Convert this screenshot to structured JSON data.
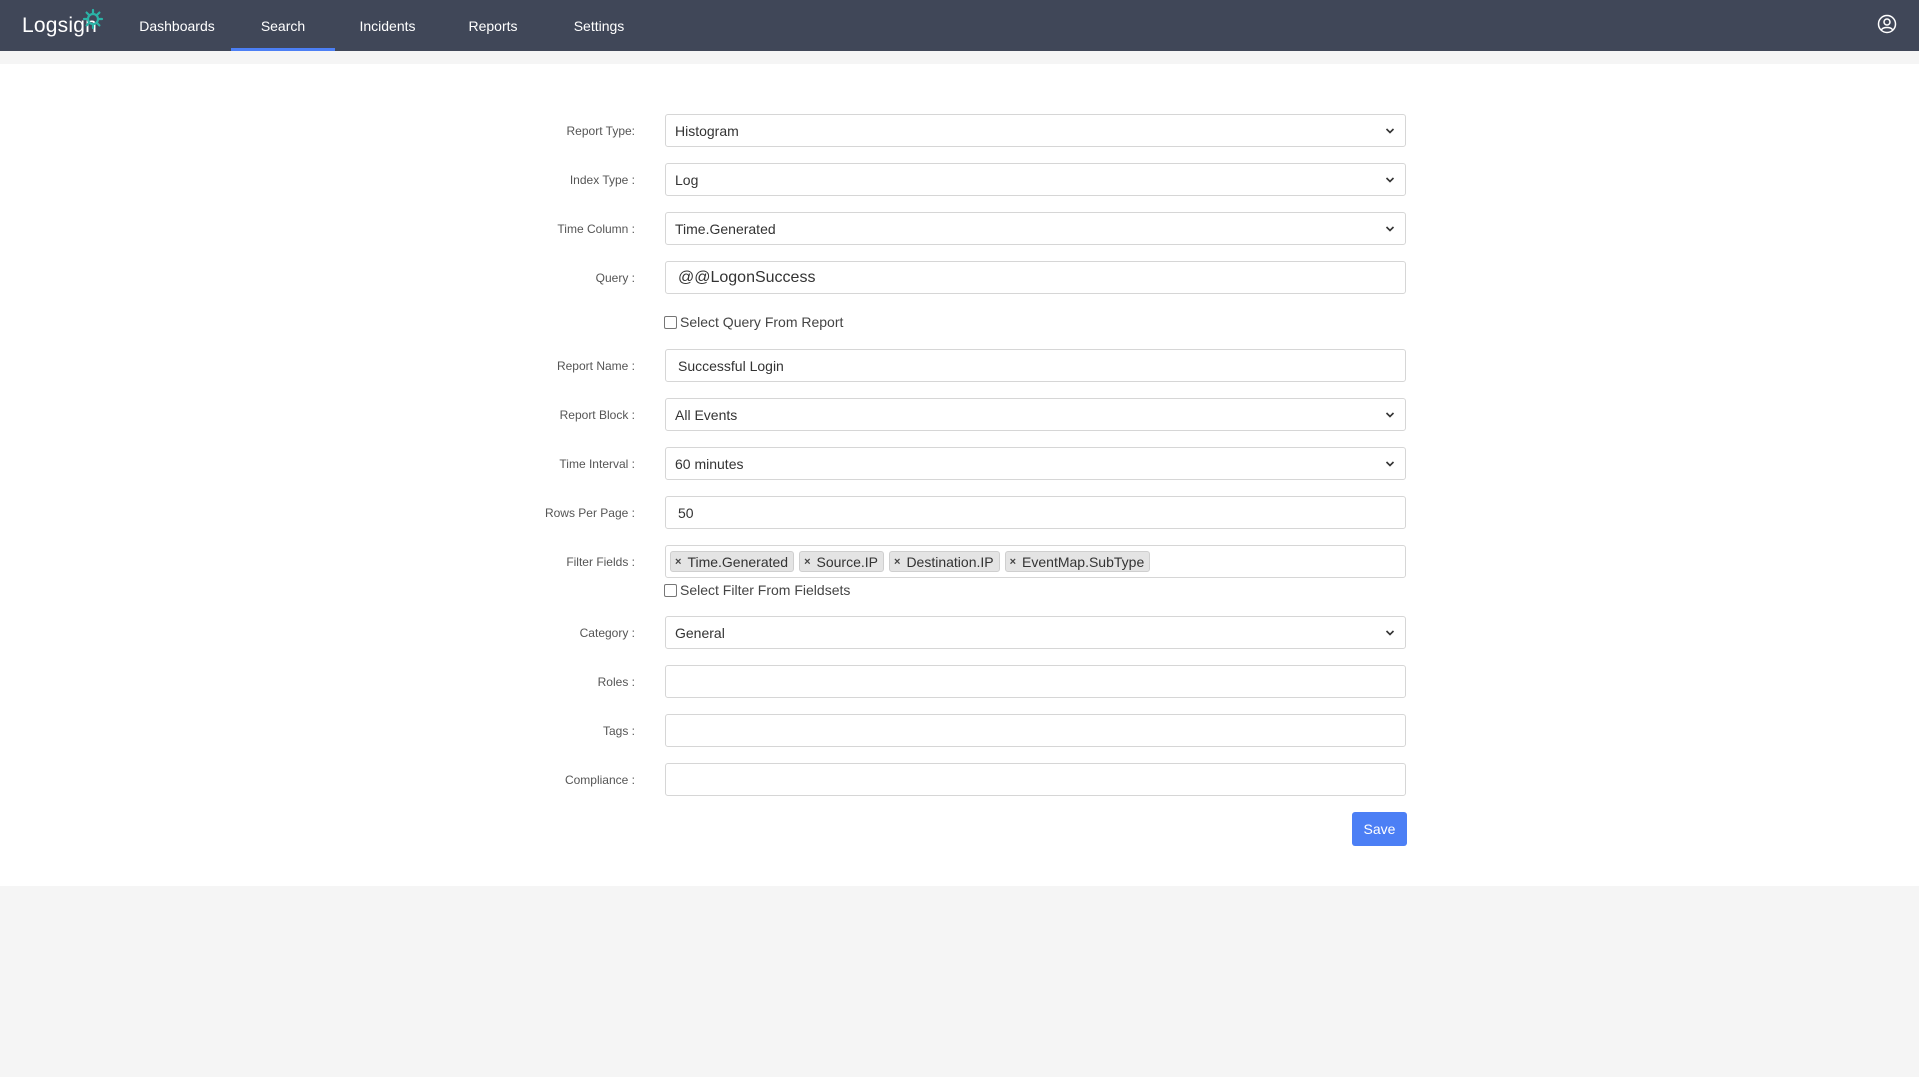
{
  "app": {
    "logo_text": "Logsign"
  },
  "nav": {
    "items": [
      {
        "label": "Dashboards"
      },
      {
        "label": "Search"
      },
      {
        "label": "Incidents"
      },
      {
        "label": "Reports"
      },
      {
        "label": "Settings"
      }
    ],
    "active": "Search"
  },
  "form": {
    "report_type": {
      "label": "Report Type:",
      "value": "Histogram"
    },
    "index_type": {
      "label": "Index Type :",
      "value": "Log"
    },
    "time_column": {
      "label": "Time Column :",
      "value": "Time.Generated"
    },
    "query": {
      "label": "Query :",
      "value": "@@LogonSuccess"
    },
    "select_query_from_report": {
      "label": "Select Query From Report",
      "checked": false
    },
    "report_name": {
      "label": "Report Name :",
      "value": "Successful Login"
    },
    "report_block": {
      "label": "Report Block :",
      "value": "All Events"
    },
    "time_interval": {
      "label": "Time Interval :",
      "value": "60 minutes"
    },
    "rows_per_page": {
      "label": "Rows Per Page :",
      "value": "50"
    },
    "filter_fields": {
      "label": "Filter Fields :",
      "tags": [
        "Time.Generated",
        "Source.IP",
        "Destination.IP",
        "EventMap.SubType"
      ],
      "remove_glyph": "×"
    },
    "select_filter_from_fieldsets": {
      "label": "Select Filter From Fieldsets",
      "checked": false
    },
    "category": {
      "label": "Category :",
      "value": "General"
    },
    "roles": {
      "label": "Roles :",
      "value": ""
    },
    "tags": {
      "label": "Tags :",
      "value": ""
    },
    "compliance": {
      "label": "Compliance :",
      "value": ""
    },
    "save_label": "Save"
  },
  "colors": {
    "topbar": "#404758",
    "accent": "#4c7ff5",
    "logo_mark": "#2bb3a6"
  },
  "icons": {
    "logo_mark": "gear-icon",
    "user": "user-circle-icon",
    "select_arrow": "chevron-down-icon",
    "tag_remove": "close-icon"
  }
}
